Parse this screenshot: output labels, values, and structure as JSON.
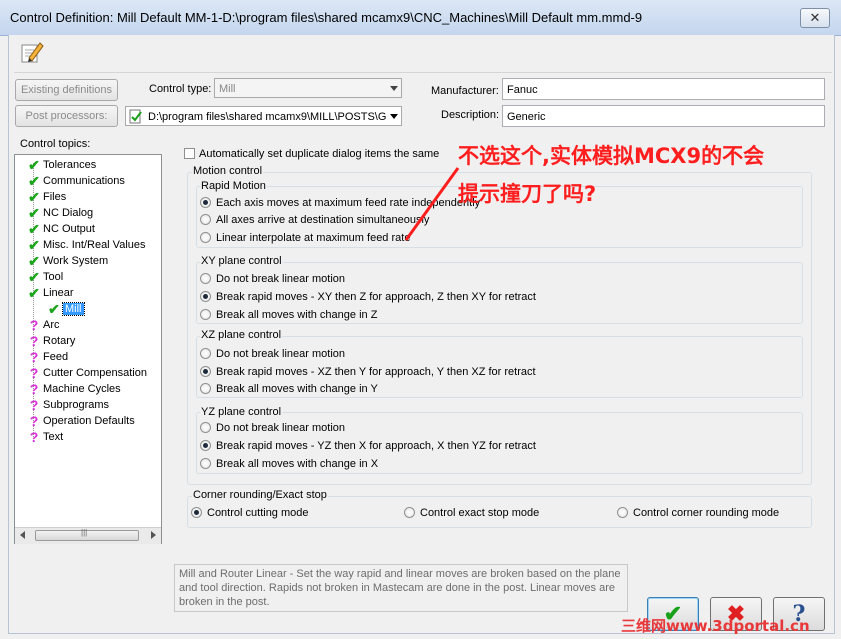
{
  "window": {
    "title": "Control Definition: Mill Default MM-1-D:\\program files\\shared mcamx9\\CNC_Machines\\Mill Default mm.mmd-9",
    "close_glyph": "✕"
  },
  "toolbar": {
    "edit_icon": "pencil-icon"
  },
  "top": {
    "existing_definitions": "Existing definitions",
    "post_processors": "Post processors:",
    "control_type_label": "Control type:",
    "control_type_value": "Mill",
    "post_path": "D:\\program files\\shared mcamx9\\MILL\\POSTS\\G",
    "manufacturer_label": "Manufacturer:",
    "manufacturer_value": "Fanuc",
    "description_label": "Description:",
    "description_value": "Generic"
  },
  "topics": {
    "label": "Control topics:",
    "items": [
      {
        "label": "Tolerances",
        "icon": "check"
      },
      {
        "label": "Communications",
        "icon": "check"
      },
      {
        "label": "Files",
        "icon": "check"
      },
      {
        "label": "NC Dialog",
        "icon": "check"
      },
      {
        "label": "NC Output",
        "icon": "check"
      },
      {
        "label": "Misc. Int/Real Values",
        "icon": "check"
      },
      {
        "label": "Work System",
        "icon": "check"
      },
      {
        "label": "Tool",
        "icon": "check"
      },
      {
        "label": "Linear",
        "icon": "check"
      },
      {
        "label": "Mill",
        "icon": "check"
      },
      {
        "label": "Arc",
        "icon": "question"
      },
      {
        "label": "Rotary",
        "icon": "question"
      },
      {
        "label": "Feed",
        "icon": "question"
      },
      {
        "label": "Cutter Compensation",
        "icon": "question"
      },
      {
        "label": "Machine Cycles",
        "icon": "question"
      },
      {
        "label": "Subprograms",
        "icon": "question"
      },
      {
        "label": "Operation Defaults",
        "icon": "question"
      },
      {
        "label": "Text",
        "icon": "question"
      }
    ]
  },
  "options": {
    "auto_duplicate": "Automatically set duplicate dialog items the same",
    "motion_control": "Motion control",
    "rapid_motion": {
      "label": "Rapid Motion",
      "opt1": "Each axis moves at maximum feed rate independently",
      "opt2": "All axes arrive at destination simultaneously",
      "opt3": "Linear interpolate at maximum feed rate"
    },
    "xy": {
      "label": "XY plane control",
      "opt1": "Do not break linear motion",
      "opt2": "Break rapid moves - XY then Z for approach, Z then XY for retract",
      "opt3": "Break all moves with change in Z"
    },
    "xz": {
      "label": "XZ plane control",
      "opt1": "Do not break linear motion",
      "opt2": "Break rapid moves - XZ then Y for approach, Y then XZ for retract",
      "opt3": "Break all moves with change in Y"
    },
    "yz": {
      "label": "YZ plane control",
      "opt1": "Do not break linear motion",
      "opt2": "Break rapid moves - YZ then X for approach, X then YZ for retract",
      "opt3": "Break all moves with change in X"
    },
    "corner": {
      "label": "Corner rounding/Exact stop",
      "opt1": "Control cutting mode",
      "opt2": "Control exact stop mode",
      "opt3": "Control corner rounding mode"
    }
  },
  "help_text": "Mill and Router Linear - Set the way rapid and linear moves are broken based on the plane and tool direction.  Rapids not broken in Mastecam are done in the post.  Linear moves are broken in the post.",
  "buttons": {
    "ok": "✔",
    "cancel": "✖",
    "help": "?"
  },
  "annotation": {
    "line1": "不选这个,实体模拟MCX9的不会",
    "line2": "提示撞刀了吗?",
    "color": "#ff1e1e"
  },
  "watermark": "三维网www.3dportal.cn"
}
